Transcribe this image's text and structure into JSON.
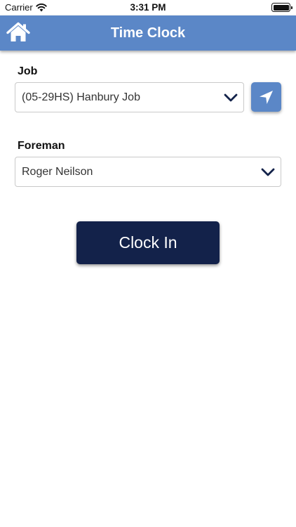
{
  "status_bar": {
    "carrier": "Carrier",
    "time": "3:31 PM",
    "wifi_icon": "wifi-icon",
    "battery_icon": "battery-icon",
    "battery_level": 1.0
  },
  "nav": {
    "title": "Time Clock",
    "home_icon": "home-icon",
    "background_color": "#5b87c7"
  },
  "form": {
    "job": {
      "label": "Job",
      "selected": "(05-29HS) Hanbury Job",
      "dropdown_icon": "chevron-down-icon",
      "location_icon": "navigation-arrow-icon"
    },
    "foreman": {
      "label": "Foreman",
      "selected": "Roger Neilson",
      "dropdown_icon": "chevron-down-icon"
    }
  },
  "actions": {
    "clock_in_label": "Clock In",
    "button_color": "#13224a"
  }
}
